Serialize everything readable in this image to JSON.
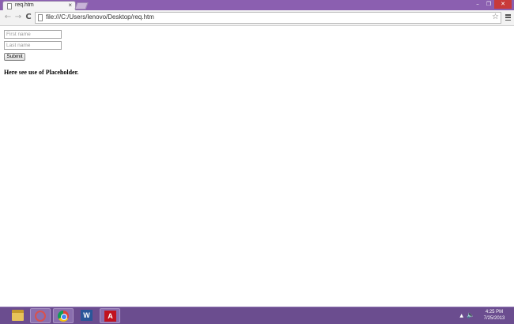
{
  "browser": {
    "tab_title": "req.htm",
    "tab_close": "×",
    "url": "file:///C:/Users/lenovo/Desktop/req.htm",
    "nav": {
      "back": "←",
      "forward": "→",
      "reload": "C"
    },
    "star": "☆",
    "window_buttons": {
      "minimize": "–",
      "restore": "❐",
      "close": "✕"
    }
  },
  "form": {
    "first_name_placeholder": "First name",
    "last_name_placeholder": "Last name",
    "submit_label": "Submit"
  },
  "content": {
    "note": "Here see use of Placeholder."
  },
  "taskbar": {
    "apps": [
      "file-explorer-icon",
      "app-icon",
      "chrome-icon",
      "word-icon",
      "acrobat-icon"
    ],
    "word_glyph": "W",
    "pdf_glyph": "A",
    "tray_arrow": "▲",
    "volume_glyph": "🔈",
    "time": "4:25 PM",
    "date": "7/25/2013"
  },
  "colors": {
    "titlebar": "#8b5fb0",
    "taskbar": "#6b4d8f"
  }
}
